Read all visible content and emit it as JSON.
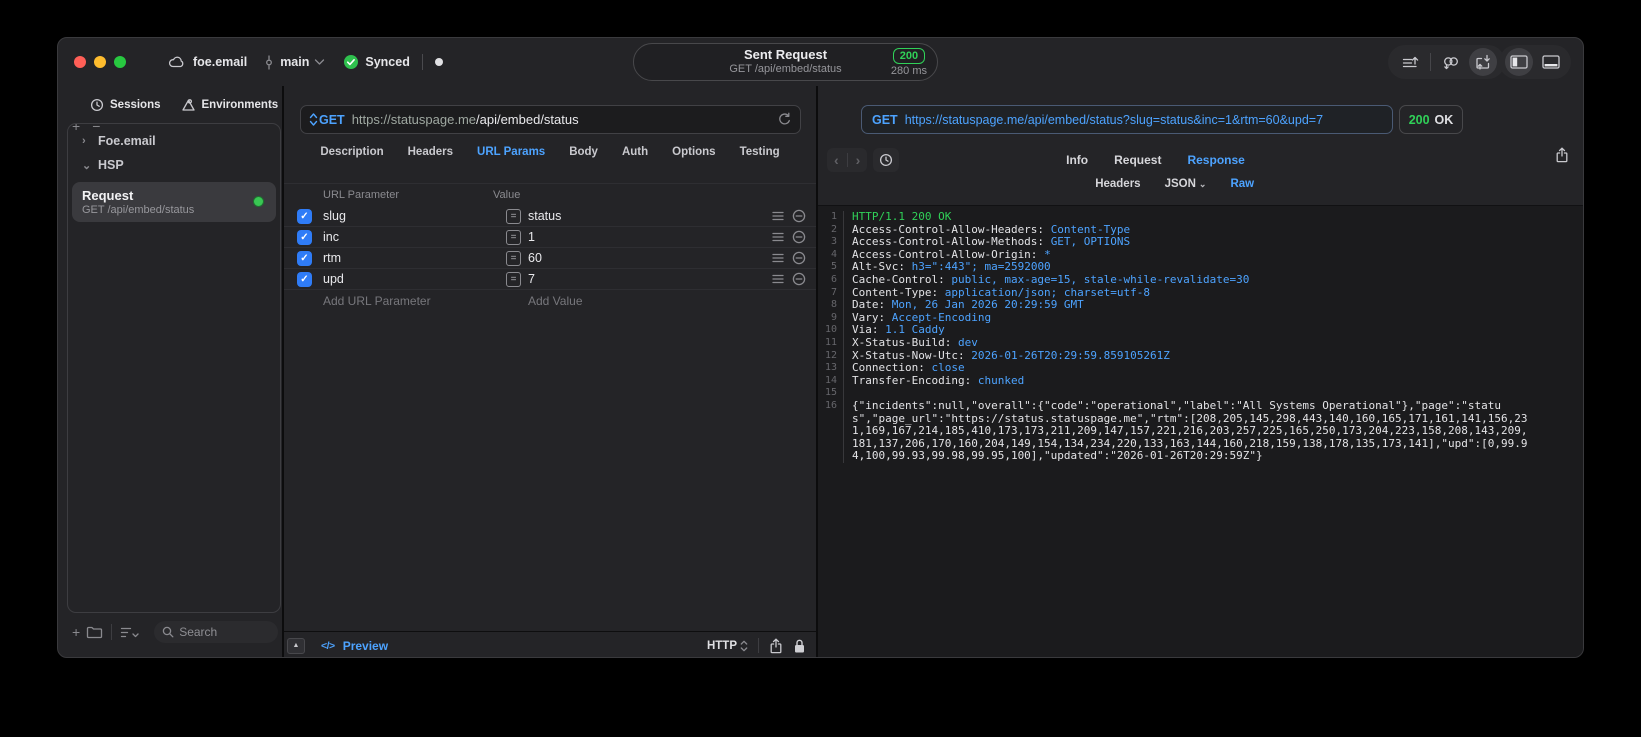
{
  "titlebar": {
    "project": "foe.email",
    "branch": "main",
    "sync_status": "Synced",
    "title": "Sent Request",
    "subtitle": "GET /api/embed/status",
    "status_code": "200",
    "duration": "280 ms"
  },
  "icons": {
    "plus": "+",
    "minus": "−",
    "chevron_down": "⌄",
    "chevron_right": "›",
    "back": "‹",
    "forward": "›",
    "equals": "=",
    "check": "✓",
    "up_triangle": "▲",
    "code": "</>"
  },
  "sidebar": {
    "tabs": {
      "sessions": "Sessions",
      "environments": "Environments"
    },
    "tree": [
      {
        "label": "Foe.email"
      },
      {
        "label": "HSP"
      }
    ],
    "selected_request": {
      "title": "Request",
      "subtitle": "GET /api/embed/status"
    },
    "search_placeholder": "Search"
  },
  "request_panel": {
    "method": "GET",
    "url_host": "https://statuspage.me",
    "url_path": "/api/embed/status",
    "tabs": [
      {
        "label": "Description",
        "cls": ""
      },
      {
        "label": "Headers",
        "cls": ""
      },
      {
        "label": "URL Params",
        "cls": "active"
      },
      {
        "label": "Body",
        "cls": ""
      },
      {
        "label": "Auth",
        "cls": ""
      },
      {
        "label": "Options",
        "cls": ""
      },
      {
        "label": "Testing",
        "cls": ""
      }
    ],
    "params": {
      "col_name": "URL Parameter",
      "col_value": "Value",
      "rows": [
        {
          "name": "slug",
          "value": "status"
        },
        {
          "name": "inc",
          "value": "1"
        },
        {
          "name": "rtm",
          "value": "60"
        },
        {
          "name": "upd",
          "value": "7"
        }
      ],
      "add_name": "Add URL Parameter",
      "add_value": "Add Value"
    },
    "footer": {
      "preview": "Preview",
      "http": "HTTP"
    }
  },
  "response_panel": {
    "method": "GET",
    "url": "https://statuspage.me/api/embed/status?slug=status&inc=1&rtm=60&upd=7",
    "status_code": "200",
    "status_text": "OK",
    "tabs": {
      "info": "Info",
      "request": "Request",
      "response": "Response"
    },
    "subtabs": {
      "headers": "Headers",
      "json": "JSON",
      "raw": "Raw"
    },
    "lines": [
      {
        "n": "1",
        "name": "HTTP/1.1 200 OK",
        "value": "",
        "cls": "status-line"
      },
      {
        "n": "2",
        "name": "Access-Control-Allow-Headers: ",
        "value": "Content-Type"
      },
      {
        "n": "3",
        "name": "Access-Control-Allow-Methods: ",
        "value": "GET, OPTIONS"
      },
      {
        "n": "4",
        "name": "Access-Control-Allow-Origin: ",
        "value": "*"
      },
      {
        "n": "5",
        "name": "Alt-Svc: ",
        "value": "h3=\":443\"; ma=2592000"
      },
      {
        "n": "6",
        "name": "Cache-Control: ",
        "value": "public, max-age=15, stale-while-revalidate=30"
      },
      {
        "n": "7",
        "name": "Content-Type: ",
        "value": "application/json; charset=utf-8"
      },
      {
        "n": "8",
        "name": "Date: ",
        "value": "Mon, 26 Jan 2026 20:29:59 GMT"
      },
      {
        "n": "9",
        "name": "Vary: ",
        "value": "Accept-Encoding"
      },
      {
        "n": "10",
        "name": "Via: ",
        "value": "1.1 Caddy"
      },
      {
        "n": "11",
        "name": "X-Status-Build: ",
        "value": "dev"
      },
      {
        "n": "12",
        "name": "X-Status-Now-Utc: ",
        "value": "2026-01-26T20:29:59.859105261Z"
      },
      {
        "n": "13",
        "name": "Connection: ",
        "value": "close"
      },
      {
        "n": "14",
        "name": "Transfer-Encoding: ",
        "value": "chunked"
      },
      {
        "n": "15",
        "name": "",
        "value": ""
      }
    ],
    "body_line_no": "16",
    "body": "{\"incidents\":null,\"overall\":{\"code\":\"operational\",\"label\":\"All Systems Operational\"},\"page\":\"status\",\"page_url\":\"https://status.statuspage.me\",\"rtm\":[208,205,145,298,443,140,160,165,171,161,141,156,231,169,167,214,185,410,173,173,211,209,147,157,221,216,203,257,225,165,250,173,204,223,158,208,143,209,181,137,206,170,160,204,149,154,134,234,220,133,163,144,160,218,159,138,178,135,173,141],\"upd\":[0,99.94,100,99.93,99.98,99.95,100],\"updated\":\"2026-01-26T20:29:59Z\"}"
  }
}
